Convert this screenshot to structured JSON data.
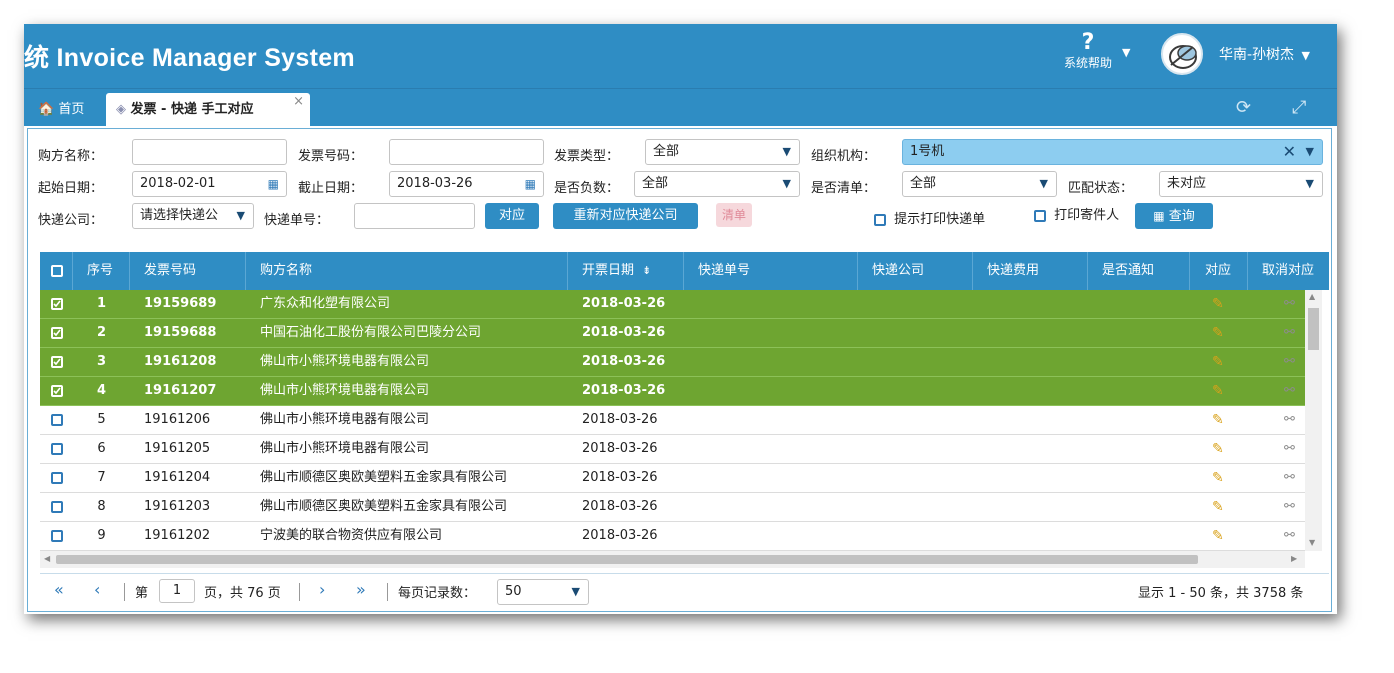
{
  "header": {
    "title": "统 Invoice Manager System",
    "help_label": "系统帮助",
    "help_glyph": "?",
    "user_name": "华南-孙树杰"
  },
  "tabs": {
    "home": "首页",
    "active": "发票 - 快递 手工对应"
  },
  "filters": {
    "buyer_label": "购方名称：",
    "buyer_value": "",
    "invoice_no_label": "发票号码：",
    "invoice_no_value": "",
    "invoice_type_label": "发票类型：",
    "invoice_type_value": "全部",
    "org_label": "组织机构：",
    "org_value": "1号机",
    "start_label": "起始日期：",
    "start_value": "2018-02-01",
    "end_label": "截止日期：",
    "end_value": "2018-03-26",
    "negative_label": "是否负数：",
    "negative_value": "全部",
    "list_label": "是否清单：",
    "list_value": "全部",
    "match_label": "匹配状态：",
    "match_value": "未对应",
    "courier_label": "快递公司：",
    "courier_placeholder": "请选择快递公",
    "tracking_label": "快递单号：",
    "tracking_value": "",
    "match_btn": "对应",
    "rematch_btn": "重新对应快递公司",
    "list_btn": "清单",
    "print_hint_label": "提示打印快递单",
    "print_sender_label": "打印寄件人",
    "query_btn": "查询"
  },
  "grid": {
    "columns": [
      "序号",
      "发票号码",
      "购方名称",
      "开票日期",
      "快递单号",
      "快递公司",
      "快递费用",
      "是否通知",
      "对应",
      "取消对应"
    ],
    "rows": [
      {
        "no": "1",
        "invoice": "19159689",
        "buyer": "广东众和化塑有限公司",
        "date": "2018-03-26",
        "selected": true
      },
      {
        "no": "2",
        "invoice": "19159688",
        "buyer": "中国石油化工股份有限公司巴陵分公司",
        "date": "2018-03-26",
        "selected": true
      },
      {
        "no": "3",
        "invoice": "19161208",
        "buyer": "佛山市小熊环境电器有限公司",
        "date": "2018-03-26",
        "selected": true
      },
      {
        "no": "4",
        "invoice": "19161207",
        "buyer": "佛山市小熊环境电器有限公司",
        "date": "2018-03-26",
        "selected": true
      },
      {
        "no": "5",
        "invoice": "19161206",
        "buyer": "佛山市小熊环境电器有限公司",
        "date": "2018-03-26",
        "selected": false
      },
      {
        "no": "6",
        "invoice": "19161205",
        "buyer": "佛山市小熊环境电器有限公司",
        "date": "2018-03-26",
        "selected": false
      },
      {
        "no": "7",
        "invoice": "19161204",
        "buyer": "佛山市顺德区奥欧美塑料五金家具有限公司",
        "date": "2018-03-26",
        "selected": false
      },
      {
        "no": "8",
        "invoice": "19161203",
        "buyer": "佛山市顺德区奥欧美塑料五金家具有限公司",
        "date": "2018-03-26",
        "selected": false
      },
      {
        "no": "9",
        "invoice": "19161202",
        "buyer": "宁波美的联合物资供应有限公司",
        "date": "2018-03-26",
        "selected": false
      }
    ]
  },
  "pager": {
    "page_prefix": "第",
    "page_value": "1",
    "page_suffix": "页，共 76 页",
    "page_size_label": "每页记录数：",
    "page_size_value": "50",
    "summary": "显示 1 - 50 条，共 3758 条"
  },
  "colors": {
    "primary": "#2f8dc4",
    "selected_row": "#6ea531",
    "org_select": "#8dcdf0"
  }
}
